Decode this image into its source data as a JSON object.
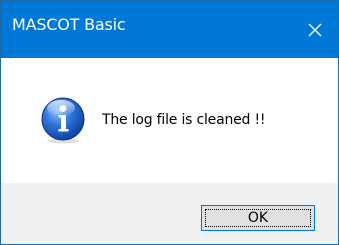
{
  "window": {
    "title": "MASCOT Basic",
    "close_icon": "close-icon",
    "titlebar_color": "#0078d7"
  },
  "message": {
    "icon": "info-icon",
    "text": "The log file is cleaned !!"
  },
  "footer": {
    "ok_label": "OK",
    "background": "#f0f0f0"
  }
}
